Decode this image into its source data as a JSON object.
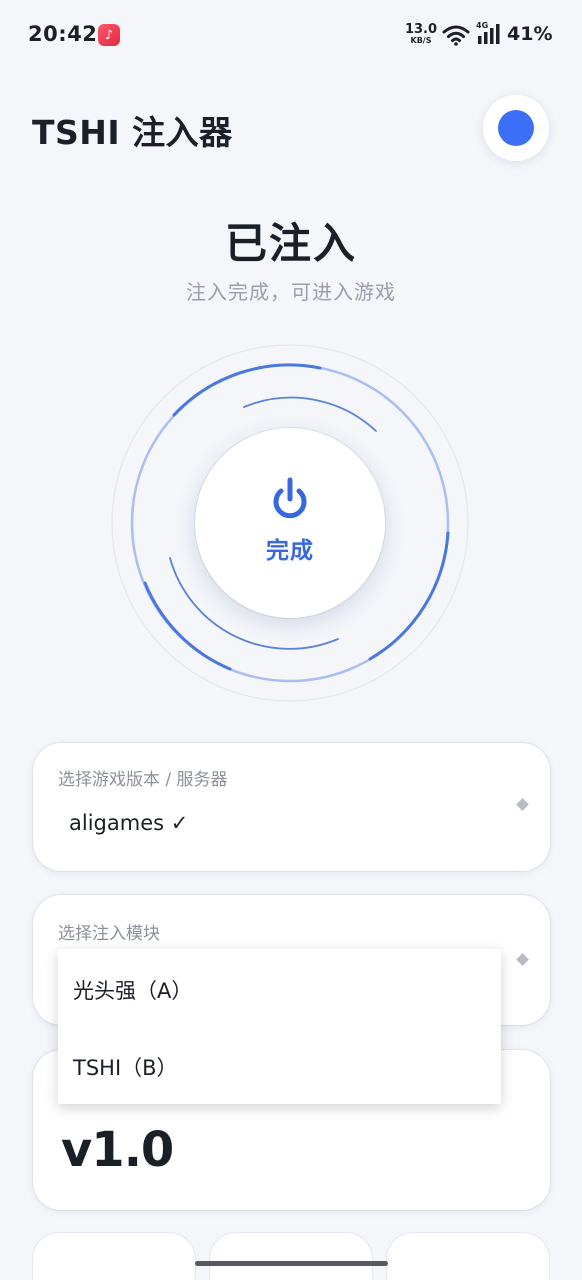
{
  "status_bar": {
    "time": "20:42",
    "net_speed_value": "13.0",
    "net_speed_unit": "KB/S",
    "cell_tag": "4G",
    "battery": "41%"
  },
  "header": {
    "title": "TSHI 注入器"
  },
  "status": {
    "title": "已注入",
    "subtitle": "注入完成，可进入游戏",
    "button_label": "完成"
  },
  "version_select": {
    "label": "选择游戏版本 / 服务器",
    "value": "aligames ✓"
  },
  "module_select": {
    "label": "选择注入模块",
    "options": [
      "光头强（A）",
      "TSHI（B）"
    ]
  },
  "version_info": {
    "version": "v1.0"
  },
  "colors": {
    "accent": "#3568e0",
    "background": "#f4f6fa"
  },
  "icons": {
    "theme_toggle": "theme-dot-icon",
    "power": "power-icon",
    "dropdown": "dropdown-caret-icon"
  }
}
